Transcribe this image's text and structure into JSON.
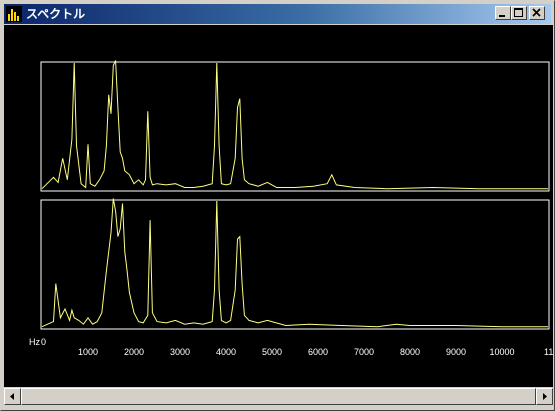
{
  "window": {
    "title": "スペクトル",
    "icon": "spectrum-app-icon",
    "buttons": [
      "minimize-icon",
      "maximize-icon",
      "close-icon"
    ]
  },
  "colors": {
    "background": "#000000",
    "trace": "#ffff80",
    "frame": "#ffffff",
    "titlebar_start": "#0a246a",
    "titlebar_end": "#a6caf0"
  },
  "x_axis": {
    "unit_label": "Hz",
    "zero_label": "0",
    "tick_labels": [
      "1000",
      "2000",
      "3000",
      "4000",
      "5000",
      "6000",
      "7000",
      "8000",
      "9000",
      "10000",
      "11"
    ]
  },
  "chart_data": [
    {
      "type": "line",
      "name": "upper-spectrum",
      "x": [
        0,
        250,
        350,
        450,
        550,
        650,
        700,
        750,
        850,
        950,
        1000,
        1050,
        1150,
        1250,
        1350,
        1400,
        1450,
        1500,
        1550,
        1600,
        1650,
        1700,
        1750,
        1800,
        1900,
        2000,
        2100,
        2200,
        2250,
        2300,
        2350,
        2400,
        2500,
        2700,
        2900,
        3100,
        3300,
        3500,
        3700,
        3750,
        3800,
        3850,
        3900,
        4000,
        4100,
        4200,
        4250,
        4300,
        4350,
        4400,
        4500,
        4700,
        4900,
        5100,
        5500,
        5900,
        6200,
        6300,
        6400,
        6800,
        7500,
        8500,
        9500,
        10500,
        11000
      ],
      "y": [
        0.01,
        0.1,
        0.06,
        0.25,
        0.08,
        0.4,
        1.0,
        0.35,
        0.05,
        0.02,
        0.36,
        0.05,
        0.03,
        0.08,
        0.15,
        0.35,
        0.75,
        0.6,
        0.98,
        1.02,
        0.65,
        0.3,
        0.25,
        0.15,
        0.12,
        0.05,
        0.08,
        0.04,
        0.08,
        0.62,
        0.1,
        0.04,
        0.05,
        0.04,
        0.05,
        0.02,
        0.02,
        0.03,
        0.05,
        0.35,
        1.0,
        0.35,
        0.05,
        0.04,
        0.05,
        0.25,
        0.65,
        0.72,
        0.25,
        0.08,
        0.05,
        0.03,
        0.06,
        0.02,
        0.02,
        0.03,
        0.05,
        0.12,
        0.04,
        0.02,
        0.01,
        0.02,
        0.01,
        0.01,
        0.01
      ],
      "xlim": [
        0,
        11000
      ],
      "ylim": [
        0,
        1.0
      ]
    },
    {
      "type": "line",
      "name": "lower-spectrum",
      "x": [
        0,
        250,
        300,
        400,
        500,
        600,
        650,
        700,
        800,
        900,
        1000,
        1100,
        1200,
        1300,
        1400,
        1450,
        1500,
        1550,
        1600,
        1650,
        1700,
        1750,
        1800,
        1850,
        1900,
        2000,
        2100,
        2200,
        2300,
        2350,
        2400,
        2500,
        2700,
        2900,
        3100,
        3300,
        3500,
        3700,
        3750,
        3800,
        3850,
        3900,
        4000,
        4100,
        4200,
        4250,
        4300,
        4350,
        4400,
        4500,
        4700,
        4900,
        5300,
        5800,
        6500,
        7300,
        7700,
        8000,
        9000,
        10000,
        11000
      ],
      "y": [
        0.01,
        0.05,
        0.35,
        0.08,
        0.15,
        0.06,
        0.14,
        0.08,
        0.06,
        0.03,
        0.08,
        0.03,
        0.05,
        0.12,
        0.45,
        0.6,
        0.75,
        1.02,
        0.92,
        0.72,
        0.78,
        0.98,
        0.6,
        0.45,
        0.28,
        0.12,
        0.05,
        0.04,
        0.1,
        0.85,
        0.12,
        0.05,
        0.04,
        0.06,
        0.03,
        0.04,
        0.03,
        0.05,
        0.3,
        1.0,
        0.3,
        0.06,
        0.04,
        0.06,
        0.3,
        0.7,
        0.72,
        0.35,
        0.1,
        0.06,
        0.04,
        0.06,
        0.02,
        0.03,
        0.02,
        0.01,
        0.03,
        0.02,
        0.02,
        0.01,
        0.01
      ],
      "xlim": [
        0,
        11000
      ],
      "ylim": [
        0,
        1.0
      ]
    }
  ]
}
